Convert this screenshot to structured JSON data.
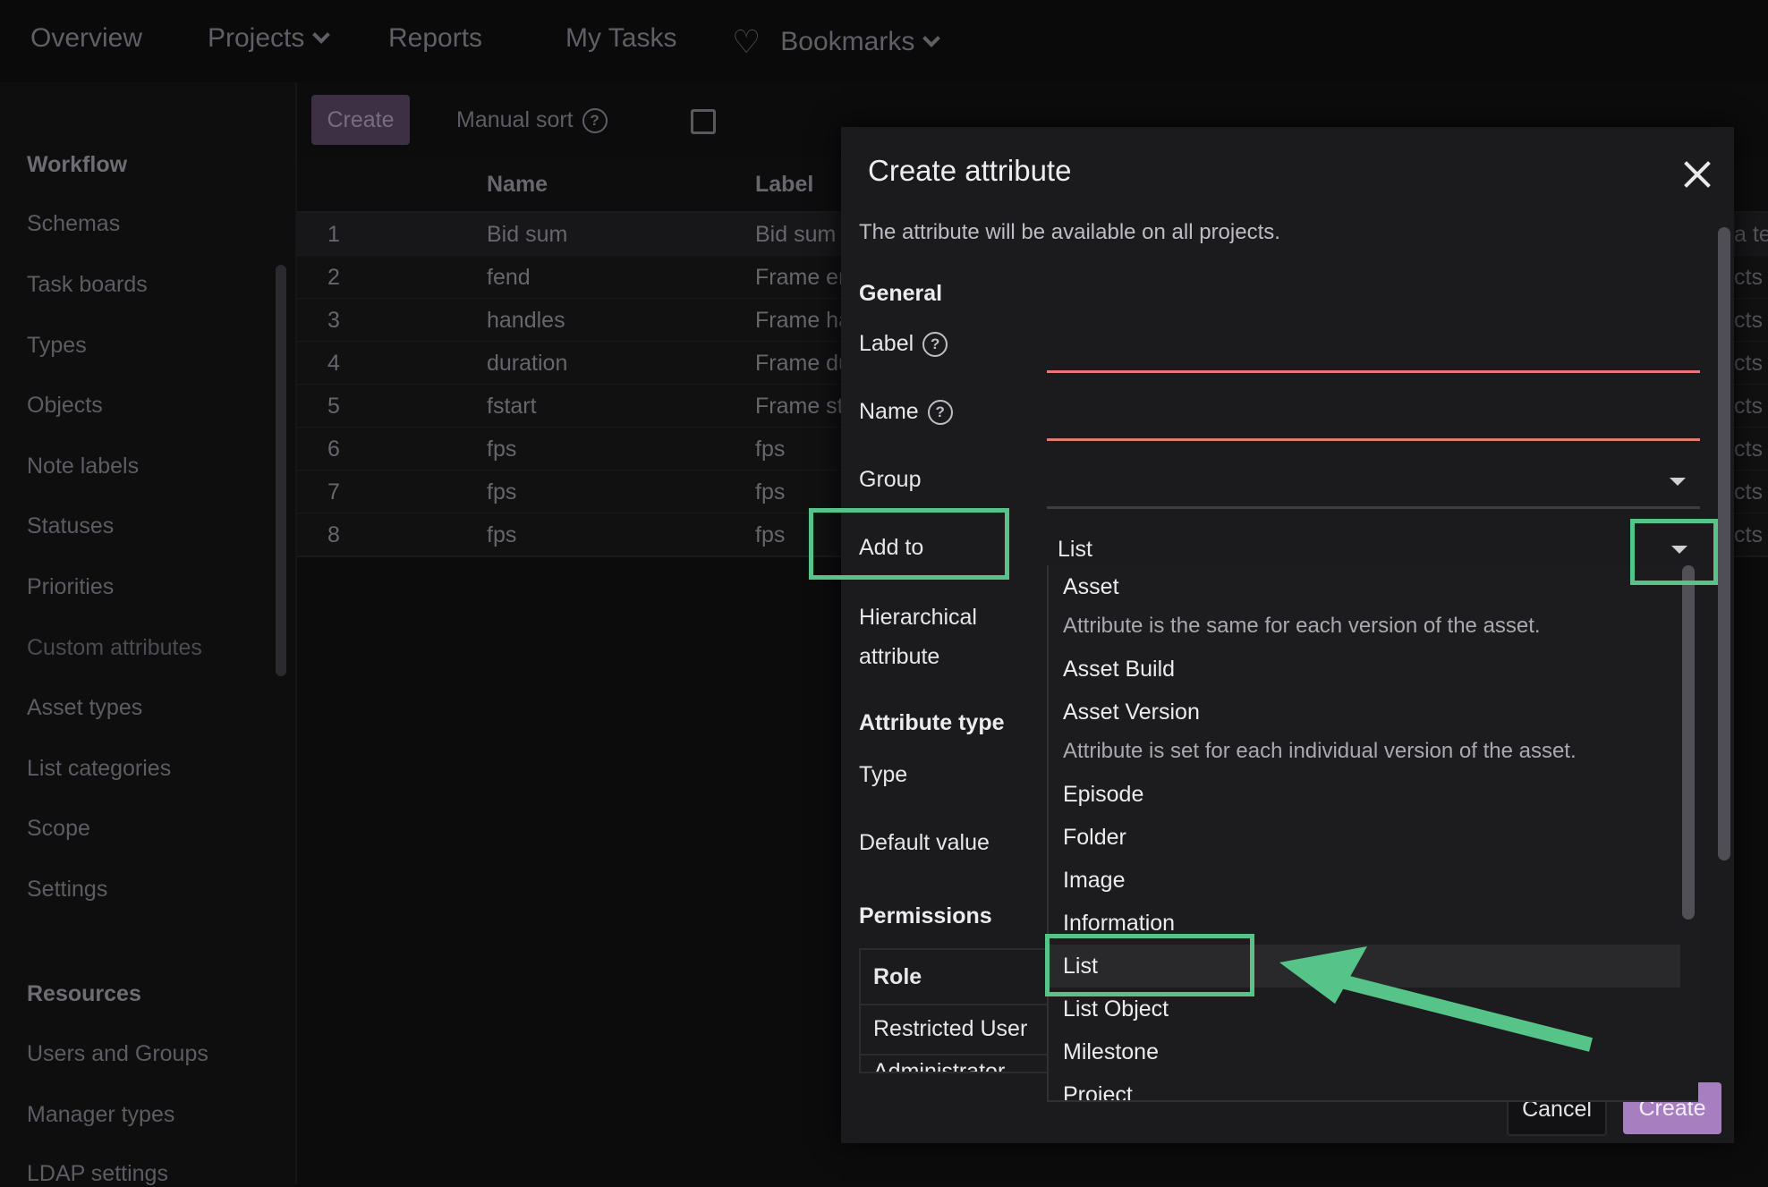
{
  "topnav": {
    "items": [
      "Overview",
      "Projects",
      "Reports",
      "My Tasks",
      "Bookmarks"
    ]
  },
  "sidebar": {
    "workflow_heading": "Workflow",
    "workflow_items": [
      "Schemas",
      "Task boards",
      "Types",
      "Objects",
      "Note labels",
      "Statuses",
      "Priorities",
      "Custom attributes",
      "Asset types",
      "List categories",
      "Scope",
      "Settings"
    ],
    "resources_heading": "Resources",
    "resources_items": [
      "Users and Groups",
      "Manager types",
      "LDAP settings"
    ]
  },
  "toolbar": {
    "create_label": "Create",
    "manual_sort_label": "Manual sort"
  },
  "table": {
    "columns": [
      "Name",
      "Label"
    ],
    "rows": [
      {
        "num": "1",
        "name": "Bid sum",
        "label": "Bid sum",
        "right": "a te"
      },
      {
        "num": "2",
        "name": "fend",
        "label": "Frame er",
        "right": "cts"
      },
      {
        "num": "3",
        "name": "handles",
        "label": "Frame ha",
        "right": "cts"
      },
      {
        "num": "4",
        "name": "duration",
        "label": "Frame du",
        "right": "cts"
      },
      {
        "num": "5",
        "name": "fstart",
        "label": "Frame st",
        "right": "cts"
      },
      {
        "num": "6",
        "name": "fps",
        "label": "fps",
        "right": "cts"
      },
      {
        "num": "7",
        "name": "fps",
        "label": "fps",
        "right": "cts"
      },
      {
        "num": "8",
        "name": "fps",
        "label": "fps",
        "right": "cts"
      }
    ]
  },
  "modal": {
    "title": "Create attribute",
    "description": "The attribute will be available on all projects.",
    "general_heading": "General",
    "label_field": "Label",
    "name_field": "Name",
    "group_field": "Group",
    "add_to_field": "Add to",
    "add_to_value": "List",
    "hierarchical_line1": "Hierarchical",
    "hierarchical_line2": "attribute",
    "attribute_type_heading": "Attribute type",
    "type_field": "Type",
    "default_value_field": "Default value",
    "permissions_heading": "Permissions",
    "permissions_table": {
      "header": "Role",
      "rows": [
        "Restricted User",
        "Administrator"
      ]
    },
    "cancel_label": "Cancel",
    "create_label": "Create"
  },
  "dropdown": {
    "options": [
      {
        "label": "Asset",
        "desc": "Attribute is the same for each version of the asset."
      },
      {
        "label": "Asset Build"
      },
      {
        "label": "Asset Version",
        "desc": "Attribute is set for each individual version of the asset."
      },
      {
        "label": "Episode"
      },
      {
        "label": "Folder"
      },
      {
        "label": "Image"
      },
      {
        "label": "Information"
      },
      {
        "label": "List"
      },
      {
        "label": "List Object"
      },
      {
        "label": "Milestone"
      },
      {
        "label": "Project"
      }
    ],
    "highlighted": "List"
  },
  "colors": {
    "accent": "#a77fc0",
    "callout": "#56c489",
    "error_underline": "#e57a73"
  },
  "icons": [
    "chevron-down-icon",
    "heart-icon",
    "help-icon",
    "close-icon",
    "dropdown-arrow-icon",
    "arrow-icon"
  ]
}
